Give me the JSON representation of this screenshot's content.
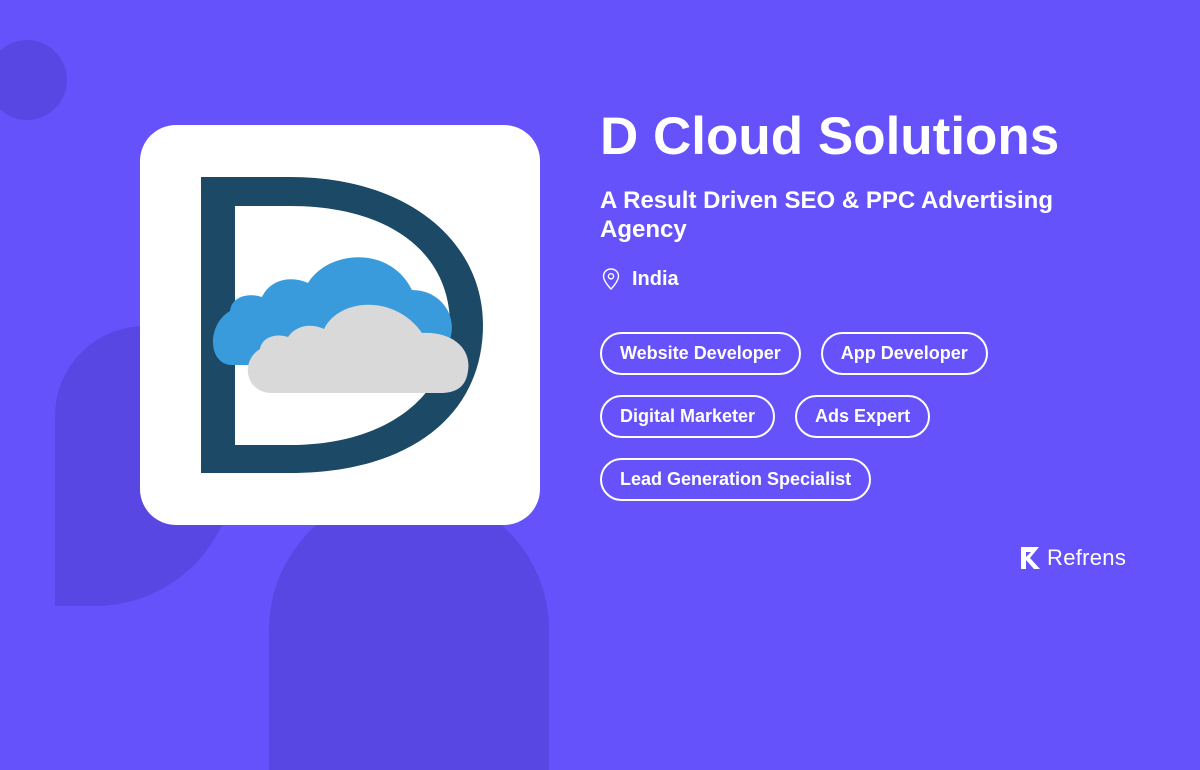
{
  "company": {
    "name": "D Cloud Solutions",
    "tagline": "A Result Driven SEO & PPC Advertising Agency",
    "location": "India"
  },
  "tags": [
    [
      "Website Developer",
      "App Developer"
    ],
    [
      "Digital Marketer",
      "Ads Expert"
    ],
    [
      "Lead Generation Specialist"
    ]
  ],
  "brand": {
    "name": "Refrens"
  },
  "icons": {
    "location": "map-pin-icon",
    "brand": "refrens-logo-icon",
    "company_logo": "d-cloud-logo-icon"
  },
  "colors": {
    "background": "#6652FB",
    "background_shape": "#5947E4",
    "logo_dark_blue": "#1B4966",
    "logo_cloud_blue": "#3A9BDC",
    "logo_cloud_gray": "#D9D9D9",
    "text": "#FFFFFF"
  }
}
